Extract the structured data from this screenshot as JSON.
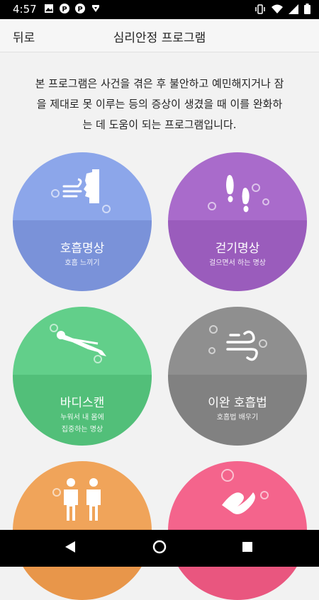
{
  "status": {
    "time": "4:57"
  },
  "header": {
    "back_label": "뒤로",
    "title": "심리안정 프로그램"
  },
  "intro": {
    "line1": "본 프로그램은 사건을 겪은 후 불안하고 예민해지거나 잠",
    "line2": "을 제대로 못 이루는 등의 증상이 생겼을 때 이를 완화하",
    "line3": "는 데 도움이 되는 프로그램입니다."
  },
  "programs": [
    {
      "label": "호흡명상",
      "sub1": "호흡 느끼기",
      "sub2": "",
      "color_top": "#8ca6ea",
      "color_bottom": "#7a92d9",
      "icon": "breath-icon"
    },
    {
      "label": "걷기명상",
      "sub1": "걸으면서 하는 명상",
      "sub2": "",
      "color_top": "#a96bcb",
      "color_bottom": "#9a5cbc",
      "icon": "footprints-icon"
    },
    {
      "label": "바디스캔",
      "sub1": "누워서 내 몸에",
      "sub2": "집중하는 명상",
      "color_top": "#62cf8a",
      "color_bottom": "#52bf79",
      "icon": "lying-person-icon"
    },
    {
      "label": "이완 호흡법",
      "sub1": "호흡법 배우기",
      "sub2": "",
      "color_top": "#8f8f8f",
      "color_bottom": "#818181",
      "icon": "wind-icon"
    },
    {
      "label": "",
      "sub1": "",
      "sub2": "",
      "color_top": "#f0a45a",
      "color_bottom": "#e8964a",
      "icon": "two-persons-icon"
    },
    {
      "label": "",
      "sub1": "",
      "sub2": "",
      "color_top": "#f4648c",
      "color_bottom": "#e9567f",
      "icon": "ribbon-icon"
    }
  ]
}
